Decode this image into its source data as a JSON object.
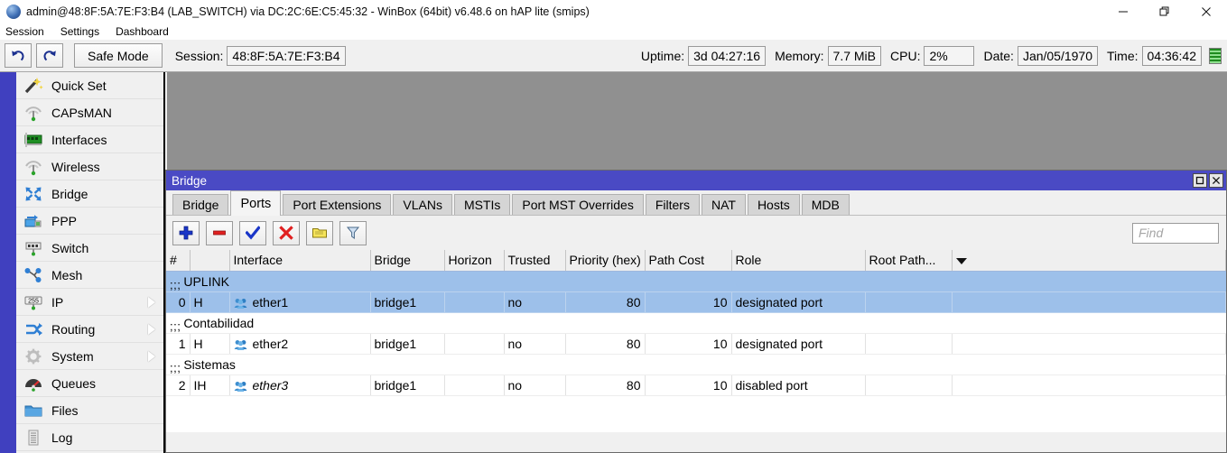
{
  "app": {
    "title": "admin@48:8F:5A:7E:F3:B4 (LAB_SWITCH) via DC:2C:6E:C5:45:32 - WinBox (64bit) v6.48.6 on hAP lite (smips)",
    "icon": "winbox-globe-icon",
    "window_controls": [
      {
        "name": "minimize-button",
        "glyph": "—"
      },
      {
        "name": "maximize-button",
        "glyph": "❐"
      },
      {
        "name": "close-button",
        "glyph": "✕"
      }
    ]
  },
  "menubar": {
    "items": [
      {
        "label": "Session"
      },
      {
        "label": "Settings"
      },
      {
        "label": "Dashboard"
      }
    ]
  },
  "toolbar": {
    "undo_icon": "undo-arrow-icon",
    "redo_icon": "redo-arrow-icon",
    "safe_mode_label": "Safe Mode",
    "session_label": "Session:",
    "session_value": "48:8F:5A:7E:F3:B4",
    "uptime_label": "Uptime:",
    "uptime_value": "3d 04:27:16",
    "memory_label": "Memory:",
    "memory_value": "7.7 MiB",
    "cpu_label": "CPU:",
    "cpu_value": "2%",
    "date_label": "Date:",
    "date_value": "Jan/05/1970",
    "time_label": "Time:",
    "time_value": "04:36:42",
    "activity_led": "activity-led-indicator"
  },
  "sidebar": {
    "items": [
      {
        "label": "Quick Set",
        "icon": "magic-wand-icon",
        "submenu": false
      },
      {
        "label": "CAPsMAN",
        "icon": "antenna-icon",
        "submenu": false
      },
      {
        "label": "Interfaces",
        "icon": "network-card-icon",
        "submenu": false
      },
      {
        "label": "Wireless",
        "icon": "antenna-icon",
        "submenu": false
      },
      {
        "label": "Bridge",
        "icon": "bridge-arrows-icon",
        "submenu": false
      },
      {
        "label": "PPP",
        "icon": "ppp-icon",
        "submenu": false
      },
      {
        "label": "Switch",
        "icon": "switch-chip-icon",
        "submenu": false
      },
      {
        "label": "Mesh",
        "icon": "mesh-nodes-icon",
        "submenu": false
      },
      {
        "label": "IP",
        "icon": "ip-255-icon",
        "submenu": true
      },
      {
        "label": "Routing",
        "icon": "routing-arrows-icon",
        "submenu": true
      },
      {
        "label": "System",
        "icon": "gear-icon",
        "submenu": true
      },
      {
        "label": "Queues",
        "icon": "gauge-icon",
        "submenu": false
      },
      {
        "label": "Files",
        "icon": "folder-icon",
        "submenu": false
      },
      {
        "label": "Log",
        "icon": "log-list-icon",
        "submenu": false
      }
    ]
  },
  "bridge_window": {
    "title": "Bridge",
    "window_controls": [
      {
        "name": "restore-button",
        "glyph": "❐"
      },
      {
        "name": "close-button",
        "glyph": "✕"
      }
    ],
    "tabs": [
      {
        "label": "Bridge",
        "active": false
      },
      {
        "label": "Ports",
        "active": true
      },
      {
        "label": "Port Extensions",
        "active": false
      },
      {
        "label": "VLANs",
        "active": false
      },
      {
        "label": "MSTIs",
        "active": false
      },
      {
        "label": "Port MST Overrides",
        "active": false
      },
      {
        "label": "Filters",
        "active": false
      },
      {
        "label": "NAT",
        "active": false
      },
      {
        "label": "Hosts",
        "active": false
      },
      {
        "label": "MDB",
        "active": false
      }
    ],
    "toolbar": [
      {
        "name": "add-button",
        "icon": "plus-icon",
        "label": "+"
      },
      {
        "name": "remove-button",
        "icon": "minus-icon",
        "label": "-"
      },
      {
        "name": "enable-button",
        "icon": "checkmark-icon",
        "label": "✔"
      },
      {
        "name": "disable-button",
        "icon": "x-cross-icon",
        "label": "✖"
      },
      {
        "name": "comment-button",
        "icon": "note-icon",
        "label": "note"
      },
      {
        "name": "filter-button",
        "icon": "funnel-icon",
        "label": "filter"
      }
    ],
    "find": {
      "placeholder": "Find",
      "value": ""
    },
    "table": {
      "columns": [
        "#",
        "",
        "Interface",
        "Bridge",
        "Horizon",
        "Trusted",
        "Priority (hex)",
        "Path Cost",
        "Role",
        "Root Path...",
        ""
      ],
      "rows": [
        {
          "type": "comment",
          "selected": true,
          "marker": ";;;",
          "comment": "UPLINK"
        },
        {
          "type": "data",
          "selected": true,
          "num": "0",
          "flags": "H",
          "icon": "interface-group-icon",
          "interface": "ether1",
          "italic": false,
          "bridge": "bridge1",
          "horizon": "",
          "trusted": "no",
          "priority": "80",
          "path_cost": "10",
          "role": "designated port",
          "root_path": ""
        },
        {
          "type": "comment",
          "selected": false,
          "marker": ";;;",
          "comment": "Contabilidad"
        },
        {
          "type": "data",
          "selected": false,
          "num": "1",
          "flags": "H",
          "icon": "interface-group-icon",
          "interface": "ether2",
          "italic": false,
          "bridge": "bridge1",
          "horizon": "",
          "trusted": "no",
          "priority": "80",
          "path_cost": "10",
          "role": "designated port",
          "root_path": ""
        },
        {
          "type": "comment",
          "selected": false,
          "marker": ";;;",
          "comment": "Sistemas"
        },
        {
          "type": "data",
          "selected": false,
          "num": "2",
          "flags": "IH",
          "icon": "interface-group-icon",
          "interface": "ether3",
          "italic": true,
          "bridge": "bridge1",
          "horizon": "",
          "trusted": "no",
          "priority": "80",
          "path_cost": "10",
          "role": "disabled port",
          "root_path": ""
        }
      ]
    }
  },
  "colors": {
    "title_blue": "#4a4ac4",
    "sidebar_strip": "#4040bf",
    "selection": "#9dc0ea",
    "desktop": "#909090",
    "chrome": "#f0f0f0"
  }
}
